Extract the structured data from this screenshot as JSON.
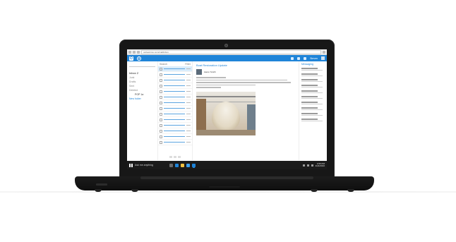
{
  "browser": {
    "url": "outlook.live.com/mail/inbox"
  },
  "app": {
    "logo_glyph": "O",
    "new_glyph": "+",
    "user_name": "Steven"
  },
  "folders": [
    {
      "label": "Inbox  2",
      "style": "active"
    },
    {
      "label": "Junk",
      "style": ""
    },
    {
      "label": "Drafts",
      "style": ""
    },
    {
      "label": "Sent",
      "style": ""
    },
    {
      "label": "Deleted",
      "style": ""
    },
    {
      "label": "POP 1a",
      "style": "indent"
    },
    {
      "label": "New folder",
      "style": "link"
    }
  ],
  "message_list": {
    "header_left": "Search",
    "header_right": "Filter"
  },
  "reading": {
    "subject": "Boat Restoration Update",
    "sender": "Aaron Smith"
  },
  "side_panel": {
    "title": "Messaging"
  },
  "taskbar": {
    "search_text": "Ask me anything",
    "clock_time": "2:05 PM",
    "clock_date": "4/24/2016"
  },
  "colors": {
    "accent": "#1f84d8",
    "bezel": "#171717",
    "taskbar": "#1b1b1b"
  }
}
